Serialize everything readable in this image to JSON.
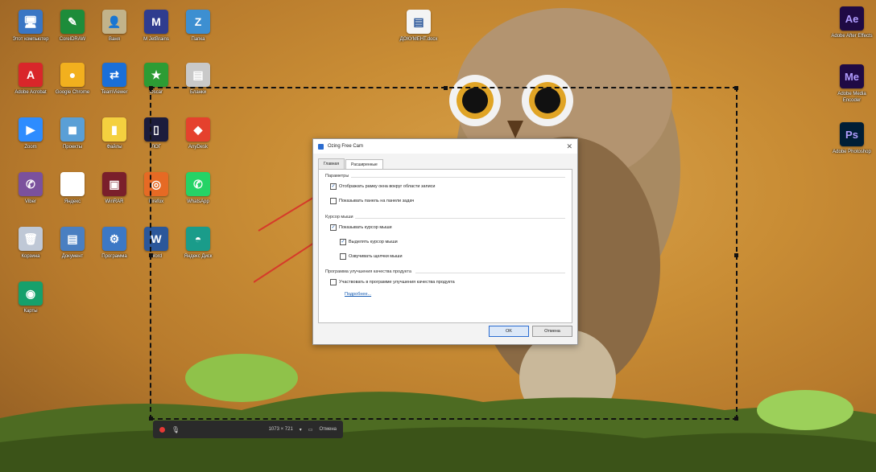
{
  "desktop": {
    "icons_left": [
      {
        "label": "Этот компьютер",
        "glyph": "🖥",
        "color": "#3a76c4"
      },
      {
        "label": "CorelDRAW",
        "glyph": "✎",
        "color": "#1d8c3a"
      },
      {
        "label": "Ваня",
        "glyph": "👤",
        "color": "#c2b38a"
      },
      {
        "label": "M JetBrains",
        "glyph": "M",
        "color": "#2f3c8f"
      },
      {
        "label": "Папка",
        "glyph": "Z",
        "color": "#3d8fd1"
      },
      {
        "label": "Adobe Acrobat",
        "glyph": "A",
        "color": "#d9262a"
      },
      {
        "label": "Google Chrome",
        "glyph": "●",
        "color": "#f2b01e"
      },
      {
        "label": "TeamViewer",
        "glyph": "⇄",
        "color": "#1a6fd8"
      },
      {
        "label": "Oscar",
        "glyph": "★",
        "color": "#2d9c34"
      },
      {
        "label": "Бланки",
        "glyph": "▤",
        "color": "#c9c9c9"
      },
      {
        "label": "Zoom",
        "glyph": "▶",
        "color": "#2d8cff"
      },
      {
        "label": "Проекты",
        "glyph": "◼",
        "color": "#5a9fd6"
      },
      {
        "label": "Файлы",
        "glyph": "▮",
        "color": "#f4d03f"
      },
      {
        "label": "ЛОГ",
        "glyph": "▯",
        "color": "#1c1c3c"
      },
      {
        "label": "AnyDesk",
        "glyph": "◆",
        "color": "#e5412d"
      },
      {
        "label": "Viber",
        "glyph": "✆",
        "color": "#7b519d"
      },
      {
        "label": "Яндекс",
        "glyph": "Y",
        "color": "#ffffff"
      },
      {
        "label": "WinRAR",
        "glyph": "▣",
        "color": "#7a1f2b"
      },
      {
        "label": "Firefox",
        "glyph": "◎",
        "color": "#e66a24"
      },
      {
        "label": "WhatsApp",
        "glyph": "✆",
        "color": "#25d366"
      },
      {
        "label": "Корзина",
        "glyph": "🗑",
        "color": "#bfc8d6"
      },
      {
        "label": "Документ",
        "glyph": "▤",
        "color": "#4a7fc1"
      },
      {
        "label": "Программа",
        "glyph": "⚙",
        "color": "#3c78c5"
      },
      {
        "label": "Word",
        "glyph": "W",
        "color": "#2b579a"
      },
      {
        "label": "Яндекс Диск",
        "glyph": "◓",
        "color": "#1a9c8a"
      },
      {
        "label": "Карты",
        "glyph": "◉",
        "color": "#16a06b"
      }
    ],
    "icons_right": [
      {
        "label": "Adobe After Effects",
        "glyph": "Ae",
        "color": "#1f0a44"
      },
      {
        "label": "Adobe Media Encoder",
        "glyph": "Me",
        "color": "#1f0a44"
      },
      {
        "label": "Adobe Photoshop",
        "glyph": "Ps",
        "color": "#001e36"
      }
    ],
    "center_file_label": "ДОКУМЕНТ.docx"
  },
  "dialog": {
    "title": "Ozing Free Cam",
    "close_glyph": "✕",
    "tabs": [
      {
        "label": "Главная",
        "active": false
      },
      {
        "label": "Расширенные",
        "active": true
      }
    ],
    "groups": {
      "recording": {
        "title": "Параметры",
        "options": [
          {
            "label": "Отображать рамку окна вокруг области записи",
            "checked": true
          },
          {
            "label": "Показывать панель на панели задач",
            "checked": false
          }
        ]
      },
      "cursor": {
        "title": "Курсор мыши",
        "options": [
          {
            "label": "Показывать курсор мыши",
            "checked": true
          },
          {
            "label": "Выделять курсор мыши",
            "checked": true
          },
          {
            "label": "Озвучивать щелчки мыши",
            "checked": false
          }
        ]
      },
      "program": {
        "title": "Программа улучшения качества продукта",
        "options": [
          {
            "label": "Участвовать в программе улучшения качества продукта",
            "checked": false
          }
        ],
        "link": "Подробнее..."
      }
    },
    "ok_label": "OK",
    "cancel_label": "Отмена"
  },
  "toolbar": {
    "size_label": "1073 × 721",
    "settings_label": "Отмена"
  },
  "colors": {
    "arrow": "#d63a2a",
    "accent": "#1a5fb4"
  }
}
